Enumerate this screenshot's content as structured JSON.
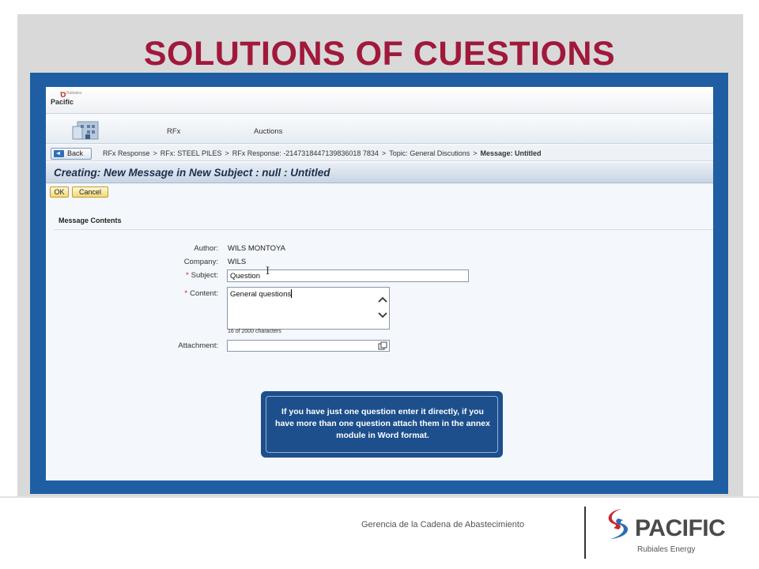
{
  "slide": {
    "title": "SOLUTIONS OF CUESTIONS",
    "footer_text": "Gerencia de la Cadena de Abastecimiento",
    "brand_name": "PACIFIC",
    "brand_subtitle": "Rubiales Energy"
  },
  "app": {
    "mini_logo_text": "Pacific",
    "mini_logo_small": "Rubiales",
    "nav_tabs": [
      {
        "label": "RFx"
      },
      {
        "label": "Auctions"
      }
    ],
    "back_label": "Back",
    "breadcrumb": [
      "RFx Response",
      "RFx: STEEL PILES",
      "RFx Response: -2147318447139836018 7834",
      "Topic: General Discutions",
      "Message: Untitled"
    ],
    "page_title": "Creating: New Message in New Subject : null : Untitled",
    "ok_label": "OK",
    "cancel_label": "Cancel",
    "section_title": "Message Contents",
    "form": {
      "author_label": "Author:",
      "author_value": "WILS MONTOYA",
      "company_label": "Company:",
      "company_value": "WILS",
      "subject_label": "Subject:",
      "subject_value": "Question",
      "content_label": "Content:",
      "content_value": "General questions",
      "char_count": "16 of 2000 characters",
      "attachment_label": "Attachment:",
      "required_mark": "*"
    },
    "callout_text": "If you have just one question enter it directly, if you have more than one question attach them in the annex module in Word format."
  },
  "colors": {
    "title_red": "#a0193b",
    "frame_blue": "#1f5ea2",
    "callout_blue": "#1d4f8c",
    "brand_red": "#c8262f",
    "brand_blue": "#2c6db5"
  }
}
